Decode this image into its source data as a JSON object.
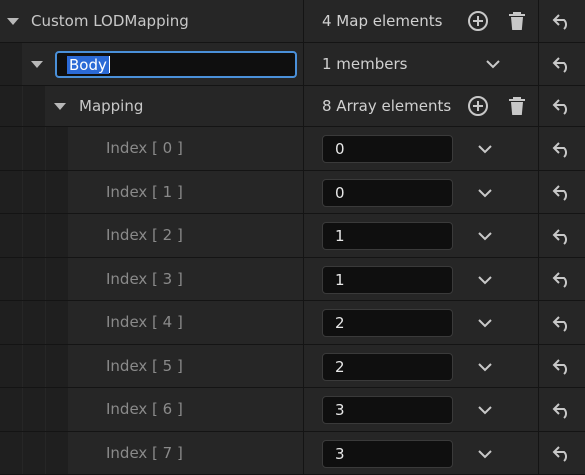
{
  "root": {
    "label": "Custom LODMapping",
    "count": "4 Map elements"
  },
  "entry": {
    "key_value": "Body",
    "count": "1 members"
  },
  "mapping": {
    "label": "Mapping",
    "count": "8 Array elements"
  },
  "elements": [
    {
      "label": "Index [ 0 ]",
      "value": "0"
    },
    {
      "label": "Index [ 1 ]",
      "value": "0"
    },
    {
      "label": "Index [ 2 ]",
      "value": "1"
    },
    {
      "label": "Index [ 3 ]",
      "value": "1"
    },
    {
      "label": "Index [ 4 ]",
      "value": "2"
    },
    {
      "label": "Index [ 5 ]",
      "value": "2"
    },
    {
      "label": "Index [ 6 ]",
      "value": "3"
    },
    {
      "label": "Index [ 7 ]",
      "value": "3"
    }
  ],
  "icons": {
    "add": "plus-circle-icon",
    "delete": "trash-icon",
    "reset": "reset-arrow-icon",
    "expand": "chevron-down-icon"
  }
}
